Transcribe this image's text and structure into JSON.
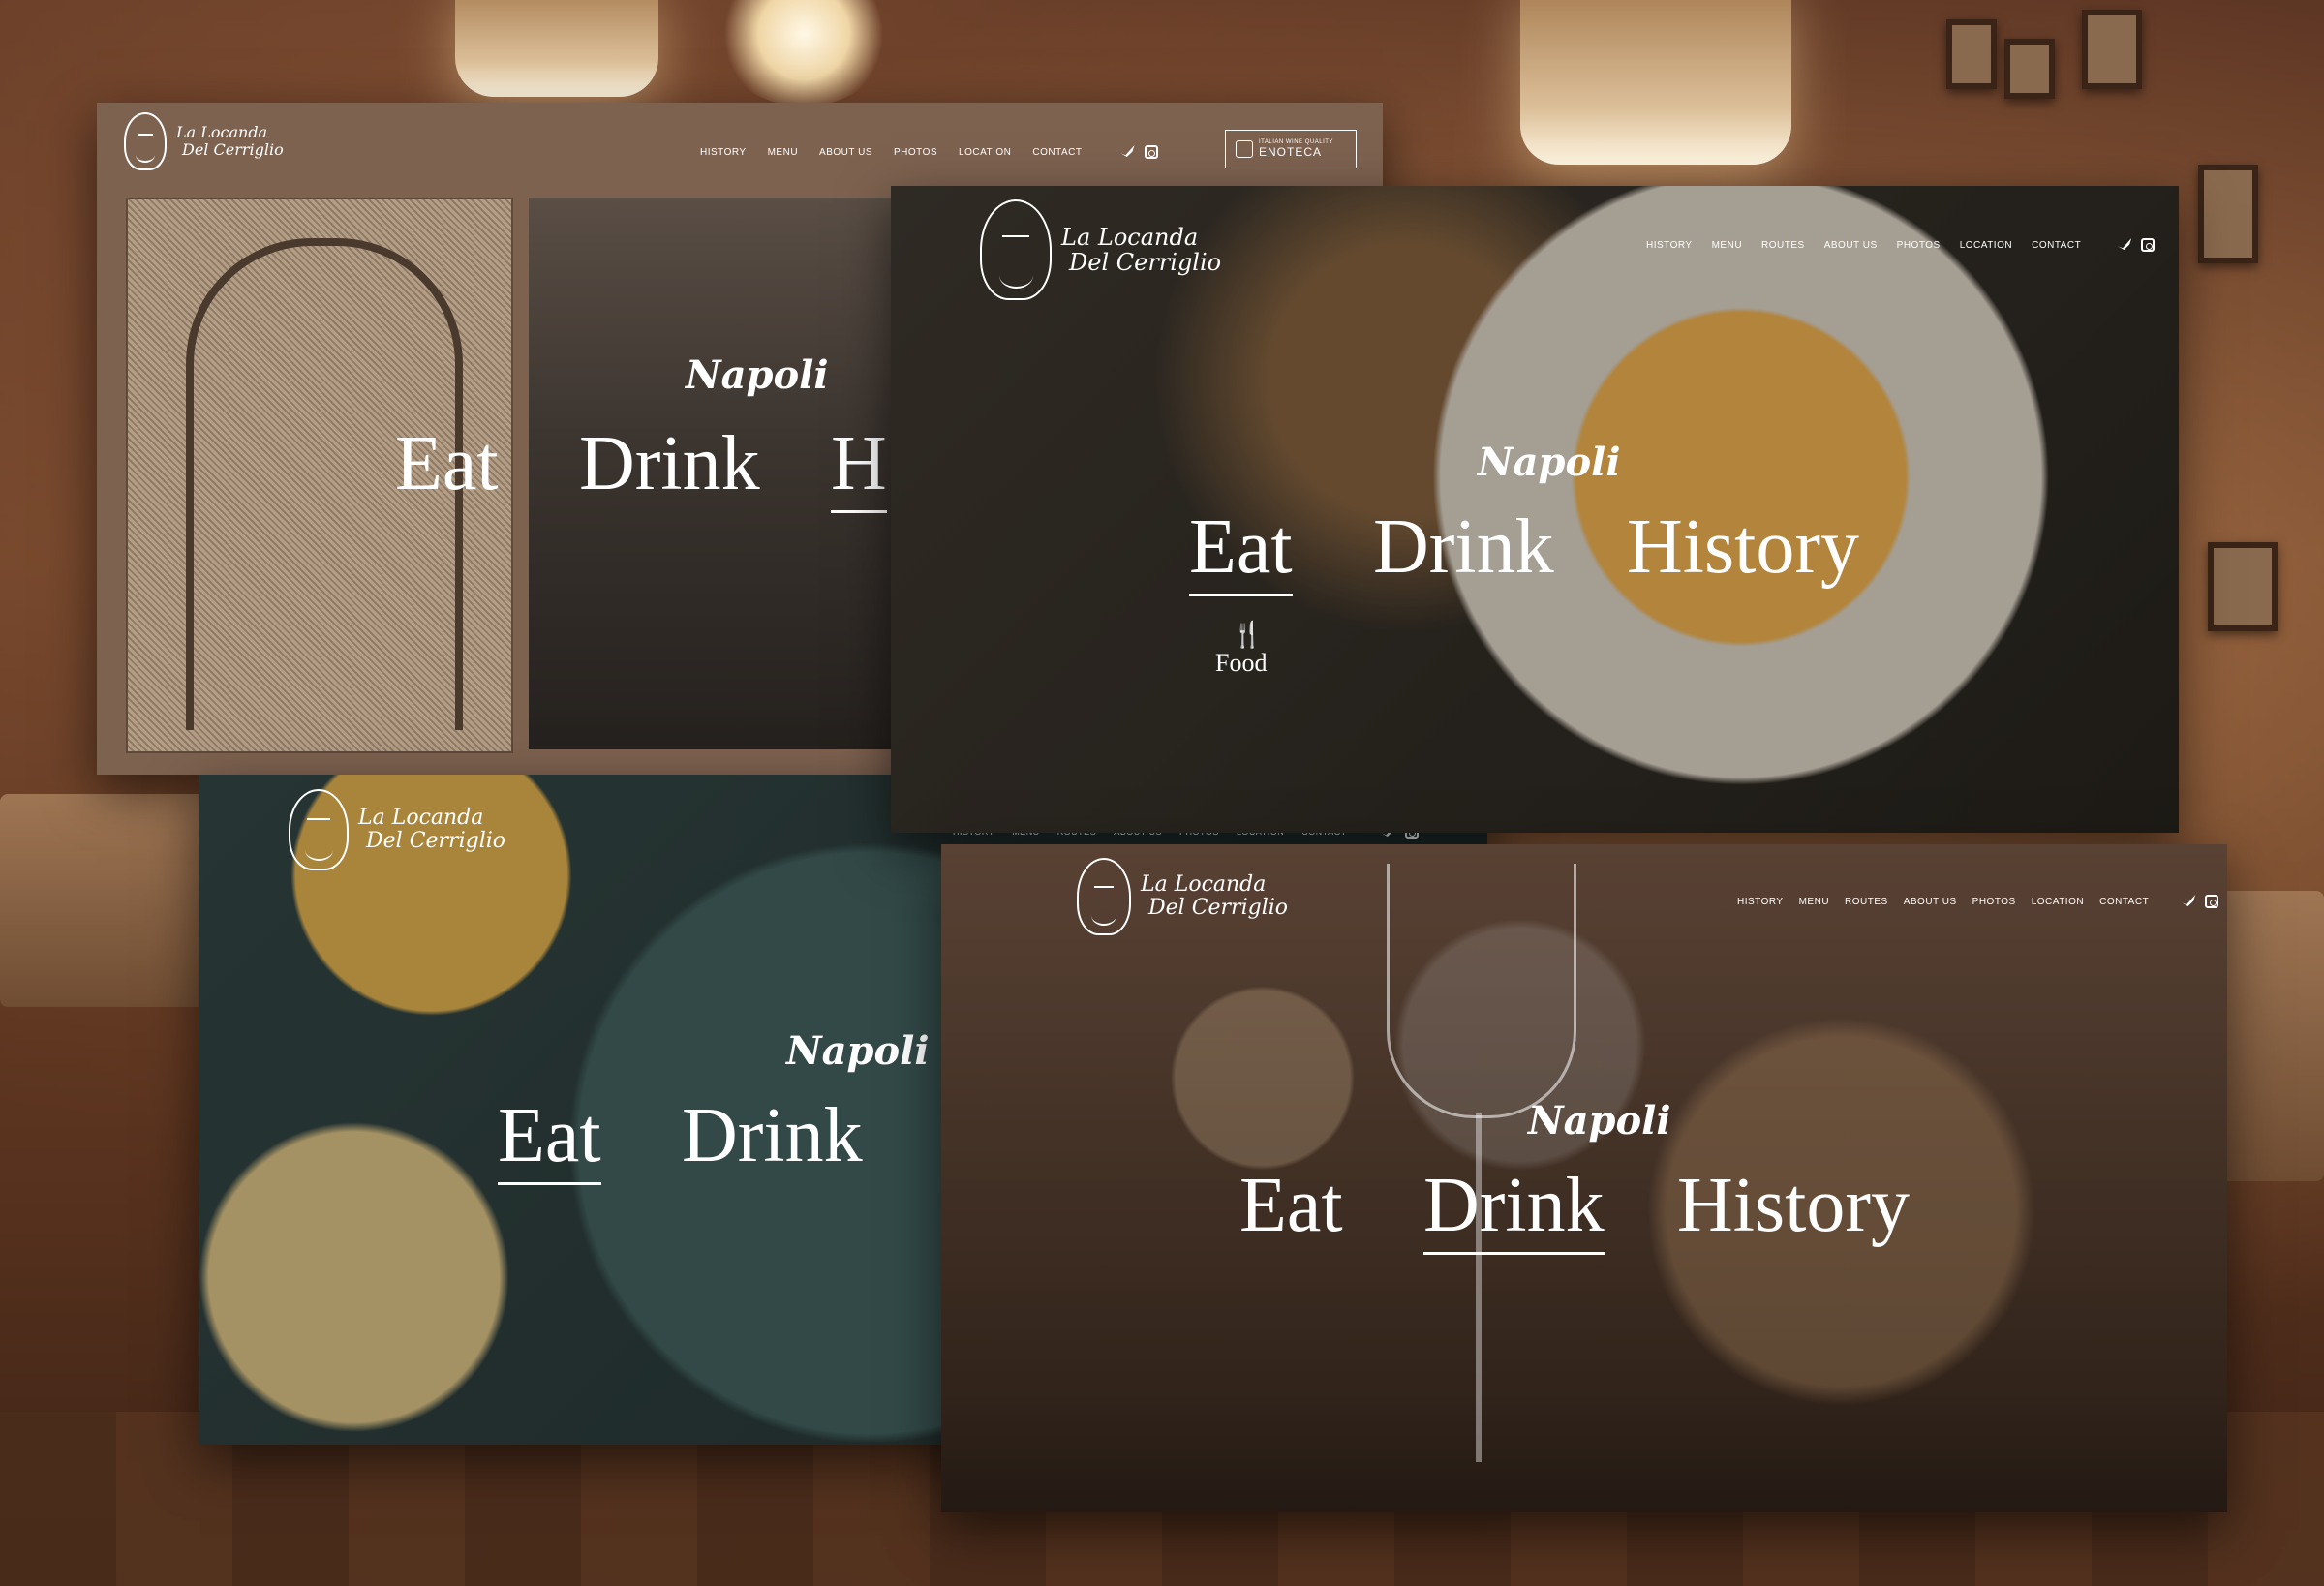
{
  "brand": {
    "line1": "La Locanda",
    "line2": "Del Cerriglio"
  },
  "nav_short": [
    "HISTORY",
    "MENU",
    "ABOUT US",
    "PHOTOS",
    "LOCATION",
    "CONTACT"
  ],
  "nav_full": [
    "HISTORY",
    "MENU",
    "ROUTES",
    "ABOUT US",
    "PHOTOS",
    "LOCATION",
    "CONTACT"
  ],
  "enoteca": {
    "small": "ITALIAN WINE QUALITY",
    "big": "ENOTECA"
  },
  "hero": {
    "city": "Napoli",
    "eat": "Eat",
    "drink": "Drink",
    "history": "History",
    "history_partial": "H"
  },
  "food_section": {
    "label": "Food"
  },
  "icons": [
    "twitter-icon",
    "instagram-icon",
    "fork-knife-icon",
    "face-logo-icon"
  ]
}
